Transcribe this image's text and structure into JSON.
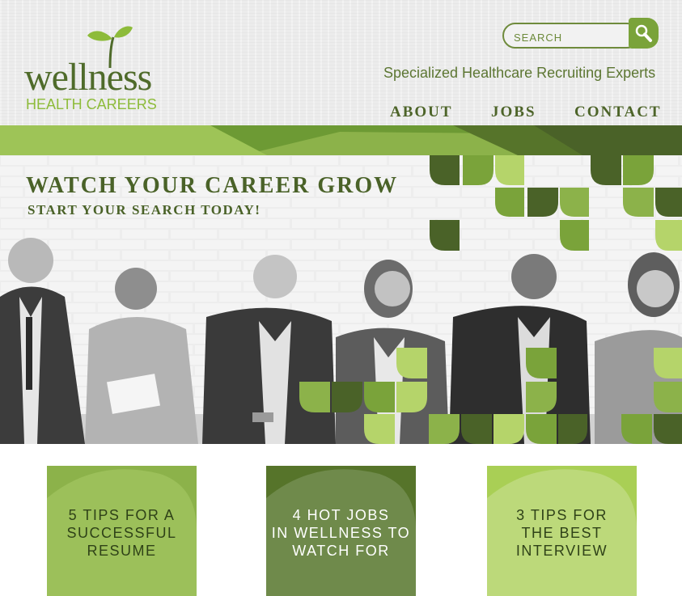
{
  "brand": {
    "name": "wellness",
    "subname": "HEALTH CAREERS",
    "tagline": "Specialized Healthcare Recruiting Experts",
    "colors": {
      "dark_green": "#4a6228",
      "mid_green": "#7aa33a",
      "light_green": "#b5d46a"
    }
  },
  "search": {
    "placeholder": "SEARCH",
    "icon": "magnifier-icon"
  },
  "nav": {
    "items": [
      "ABOUT",
      "JOBS",
      "CONTACT"
    ]
  },
  "hero": {
    "title": "WATCH YOUR CAREER GROW",
    "subtitle": "START YOUR SEARCH TODAY!"
  },
  "tiles": [
    {
      "label": "5 TIPS FOR A\nSUCCESSFUL\nRESUME",
      "color": "#8cb24a",
      "text_color": "#2f4218"
    },
    {
      "label": "4 HOT JOBS\nIN WELLNESS TO\nWATCH FOR",
      "color": "#6f8a4b",
      "text_color": "#ffffff"
    },
    {
      "label": "3 TIPS FOR\nTHE BEST\nINTERVIEW",
      "color": "#b4d66d",
      "text_color": "#2f4218"
    }
  ]
}
